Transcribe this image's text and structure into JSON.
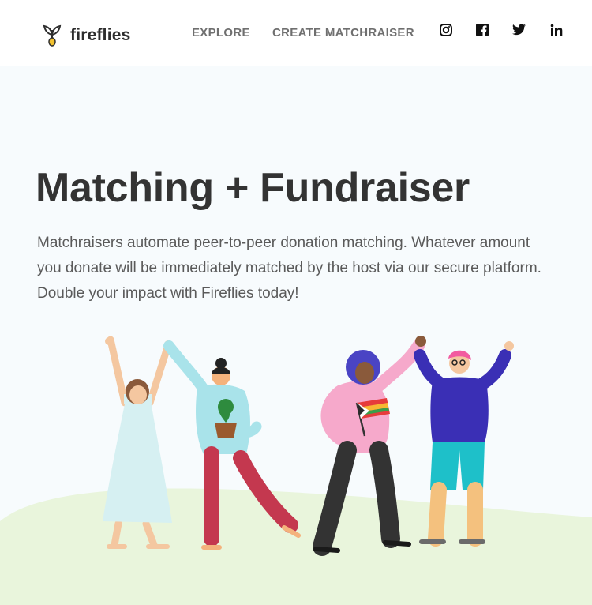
{
  "header": {
    "brand": "fireflies",
    "nav": [
      {
        "label": "EXPLORE"
      },
      {
        "label": "CREATE MATCHRAISER"
      }
    ],
    "social_icons": [
      "instagram-icon",
      "facebook-icon",
      "twitter-icon",
      "linkedin-icon"
    ]
  },
  "hero": {
    "title": "Matching + Fundraiser",
    "description": "Matchraisers automate peer-to-peer donation matching. Whatever amount you donate will be immediately matched by the host via our secure platform. Double your impact with Fireflies today!"
  },
  "colors": {
    "background": "#f7fbfd",
    "header": "#ffffff",
    "ground": "#e9f5dc",
    "title": "#333333",
    "text": "#5a5a5a",
    "nav": "#6f6f6f"
  }
}
